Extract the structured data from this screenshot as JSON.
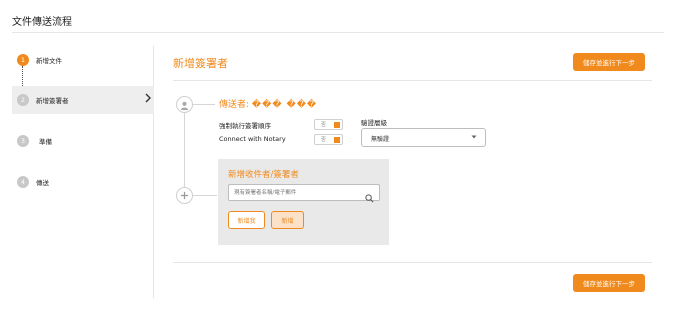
{
  "page_title": "文件傳送流程",
  "steps": [
    {
      "number": "1",
      "label": "新增文件",
      "state": "done"
    },
    {
      "number": "2",
      "label": "新增簽署者",
      "state": "active"
    },
    {
      "number": "3",
      "label": "準備",
      "state": "pending"
    },
    {
      "number": "4",
      "label": "傳送",
      "state": "pending"
    }
  ],
  "main": {
    "title": "新增簽署者",
    "save_next_label": "儲存並進行下一步",
    "sender_prefix": "傳送者:",
    "sender_name": "��� ���",
    "options": {
      "enforce_order_label": "強制執行簽署順序",
      "notary_label": "Connect with Notary",
      "toggle_off_text": "否"
    },
    "auth": {
      "label": "驗證層級",
      "value": "無驗證"
    },
    "recipient_panel": {
      "title": "新增收件者/簽署者",
      "search_placeholder": "現有簽署者名稱/電子郵件",
      "add_me_label": "新增我",
      "add_label": "新增"
    }
  },
  "colors": {
    "accent": "#f08a1c",
    "panel_bg": "#e9e9e9",
    "active_step_bg": "#eeeeee"
  },
  "icons": [
    "user-icon",
    "plus-icon",
    "search-icon",
    "chevron-right-icon",
    "caret-down-icon"
  ]
}
